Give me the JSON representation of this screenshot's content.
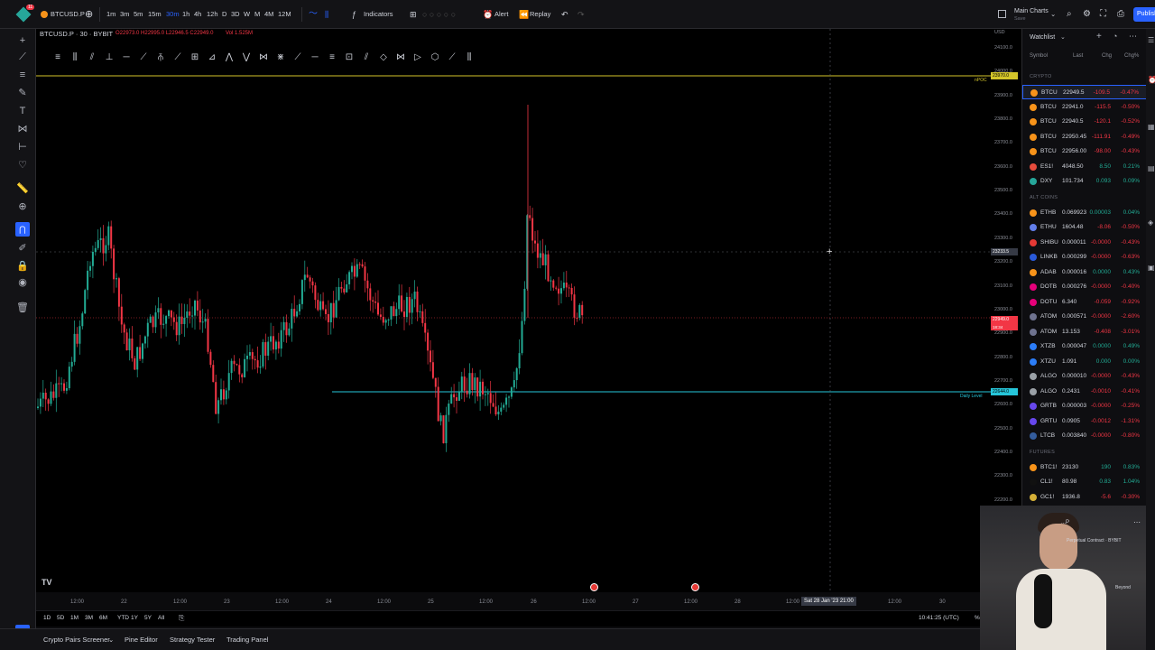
{
  "topbar": {
    "symbol": "BTCUSD.P",
    "timeframes": [
      "1m",
      "3m",
      "5m",
      "15m",
      "30m",
      "1h",
      "4h",
      "12h",
      "D",
      "3D",
      "W",
      "M",
      "4M",
      "12M"
    ],
    "active_timeframe": "30m",
    "indicators_label": "Indicators",
    "alert_label": "Alert",
    "replay_label": "Replay",
    "layout_label": "Main Charts",
    "layout_sub": "Save",
    "publish_label": "Publish",
    "notification_count": "11"
  },
  "legend": {
    "title": "BTCUSD.P · 30 · BYBIT",
    "ohlc": "O22973.0 H22995.0 L22946.5 C22949.0",
    "volume": "Vol 1.525M"
  },
  "chart": {
    "npoc_label": "nPOC",
    "npoc_price": "23970.0",
    "daily_level_label": "Daily Level",
    "daily_level_price": "22644.0",
    "last_price": "22949.0",
    "last_price_countdown": "18:34",
    "crosshair_price": "23233.5",
    "currency": "USD",
    "crosshair_time": "Sat 28 Jan '23  21:00",
    "y_ticks": [
      "24100.0",
      "24000.0",
      "23900.0",
      "23800.0",
      "23700.0",
      "23600.0",
      "23500.0",
      "23400.0",
      "23300.0",
      "23200.0",
      "23100.0",
      "23000.0",
      "22900.0",
      "22800.0",
      "22700.0",
      "22600.0",
      "22500.0",
      "22400.0",
      "22300.0",
      "22200.0",
      "22100.0",
      "22000.0",
      "21900.0"
    ],
    "x_ticks": [
      "12:00",
      "22",
      "12:00",
      "23",
      "12:00",
      "24",
      "12:00",
      "25",
      "12:00",
      "26",
      "12:00",
      "27",
      "12:00",
      "28",
      "12:00",
      "12:00",
      "30"
    ]
  },
  "bottom_range": {
    "ranges": [
      "1D",
      "5D",
      "1M",
      "3M",
      "6M",
      "YTD",
      "1Y",
      "5Y",
      "All"
    ],
    "clock": "10:41:25 (UTC)",
    "percent": "%"
  },
  "bottom_tabs": [
    "Crypto Pairs Screener",
    "Pine Editor",
    "Strategy Tester",
    "Trading Panel"
  ],
  "watchlist": {
    "title": "Watchlist",
    "columns": [
      "Symbol",
      "Last",
      "Chg",
      "Chg%"
    ],
    "sections": [
      {
        "name": "CRYPTO",
        "rows": [
          {
            "sym": "BTCU",
            "last": "22949.5",
            "chg": "-109.5",
            "pct": "-0.47%",
            "dir": "neg",
            "color": "#f7931a",
            "selected": true
          },
          {
            "sym": "BTCU",
            "last": "22941.0",
            "chg": "-115.5",
            "pct": "-0.50%",
            "dir": "neg",
            "color": "#f7931a"
          },
          {
            "sym": "BTCU",
            "last": "22940.5",
            "chg": "-120.1",
            "pct": "-0.52%",
            "dir": "neg",
            "color": "#f7931a"
          },
          {
            "sym": "BTCU",
            "last": "22950.45",
            "chg": "-111.91",
            "pct": "-0.49%",
            "dir": "neg",
            "color": "#f7931a"
          },
          {
            "sym": "BTCU",
            "last": "22956.00",
            "chg": "-98.00",
            "pct": "-0.43%",
            "dir": "neg",
            "color": "#f7931a"
          },
          {
            "sym": "ES1!",
            "last": "4048.50",
            "chg": "8.50",
            "pct": "0.21%",
            "dir": "pos",
            "color": "#e74c3c"
          },
          {
            "sym": "DXY",
            "last": "101.734",
            "chg": "0.093",
            "pct": "0.09%",
            "dir": "pos",
            "color": "#26a69a"
          }
        ]
      },
      {
        "name": "ALT COINS",
        "rows": [
          {
            "sym": "ETHB",
            "last": "0.069923",
            "chg": "0.00003",
            "pct": "0.04%",
            "dir": "pos",
            "color": "#f7931a"
          },
          {
            "sym": "ETHU",
            "last": "1604.48",
            "chg": "-8.06",
            "pct": "-0.50%",
            "dir": "neg",
            "color": "#627eea"
          },
          {
            "sym": "SHIBU",
            "last": "0.000011",
            "chg": "-0.0000",
            "pct": "-0.43%",
            "dir": "neg",
            "color": "#e53935"
          },
          {
            "sym": "LINKB",
            "last": "0.000299",
            "chg": "-0.0000",
            "pct": "-0.63%",
            "dir": "neg",
            "color": "#2a5ada"
          },
          {
            "sym": "ADAB",
            "last": "0.000016",
            "chg": "0.0000",
            "pct": "0.43%",
            "dir": "pos",
            "color": "#f7931a"
          },
          {
            "sym": "DOTB",
            "last": "0.000276",
            "chg": "-0.0000",
            "pct": "-0.40%",
            "dir": "neg",
            "color": "#e6007a"
          },
          {
            "sym": "DOTU",
            "last": "6.340",
            "chg": "-0.059",
            "pct": "-0.92%",
            "dir": "neg",
            "color": "#e6007a"
          },
          {
            "sym": "ATOM",
            "last": "0.000571",
            "chg": "-0.0000",
            "pct": "-2.60%",
            "dir": "neg",
            "color": "#6f7390"
          },
          {
            "sym": "ATOM",
            "last": "13.153",
            "chg": "-0.408",
            "pct": "-3.01%",
            "dir": "neg",
            "color": "#6f7390"
          },
          {
            "sym": "XTZB",
            "last": "0.000047",
            "chg": "0.0000",
            "pct": "0.49%",
            "dir": "pos",
            "color": "#2c7df7"
          },
          {
            "sym": "XTZU",
            "last": "1.091",
            "chg": "0.000",
            "pct": "0.00%",
            "dir": "pos",
            "color": "#2c7df7"
          },
          {
            "sym": "ALGO",
            "last": "0.000010",
            "chg": "-0.0000",
            "pct": "-0.43%",
            "dir": "neg",
            "color": "#9aa0a6"
          },
          {
            "sym": "ALGO",
            "last": "0.2431",
            "chg": "-0.0010",
            "pct": "-0.41%",
            "dir": "neg",
            "color": "#9aa0a6"
          },
          {
            "sym": "GRTB",
            "last": "0.000003",
            "chg": "-0.0000",
            "pct": "-0.25%",
            "dir": "neg",
            "color": "#6747ed"
          },
          {
            "sym": "GRTU",
            "last": "0.0905",
            "chg": "-0.0012",
            "pct": "-1.31%",
            "dir": "neg",
            "color": "#6747ed"
          },
          {
            "sym": "LTCB",
            "last": "0.003840",
            "chg": "-0.0000",
            "pct": "-0.80%",
            "dir": "neg",
            "color": "#345d9d"
          }
        ]
      },
      {
        "name": "FUTURES",
        "rows": [
          {
            "sym": "BTC1!",
            "last": "23130",
            "chg": "190",
            "pct": "0.83%",
            "dir": "pos",
            "color": "#f7931a"
          },
          {
            "sym": "CL1!",
            "last": "80.98",
            "chg": "0.83",
            "pct": "1.04%",
            "dir": "pos",
            "color": "#111111"
          },
          {
            "sym": "GC1!",
            "last": "1936.8",
            "chg": "-5.6",
            "pct": "-0.30%",
            "dir": "neg",
            "color": "#d4af37"
          }
        ]
      }
    ]
  },
  "webcam": {
    "symbol_fragment": "...P",
    "contract_label": "Perpetual Contract · BYBIT",
    "beyond_label": "Beyond"
  }
}
